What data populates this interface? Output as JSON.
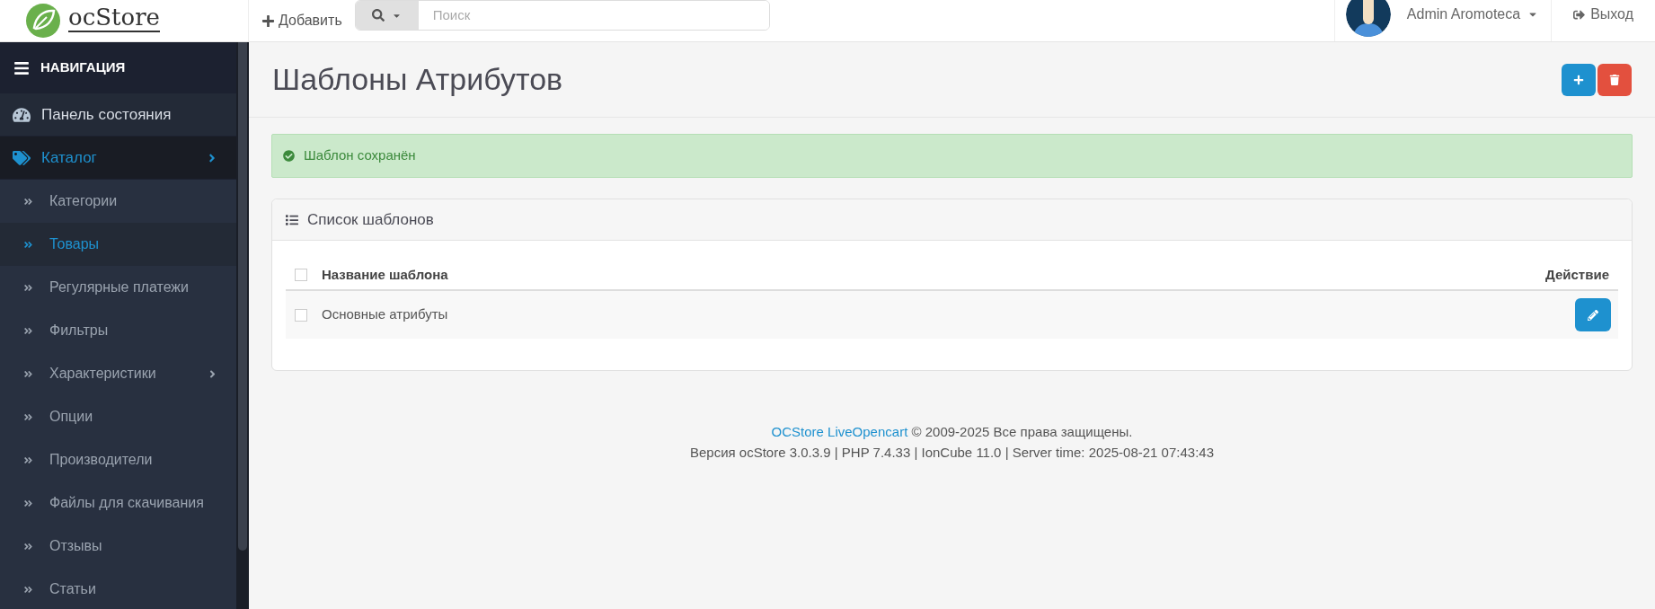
{
  "header": {
    "logo": "ocStore",
    "add_label": "Добавить",
    "search": {
      "placeholder": "Поиск"
    },
    "user": "Admin Aromoteca",
    "logout": "Выход"
  },
  "sidebar": {
    "title": "НАВИГАЦИЯ",
    "items": [
      {
        "label": "Панель состояния",
        "selected": false
      },
      {
        "label": "Каталог",
        "selected": true,
        "expanded": true,
        "children": [
          {
            "label": "Категории",
            "selected": false,
            "expandable": false
          },
          {
            "label": "Товары",
            "selected": true,
            "expandable": false
          },
          {
            "label": "Регулярные платежи",
            "selected": false,
            "expandable": false
          },
          {
            "label": "Фильтры",
            "selected": false,
            "expandable": false
          },
          {
            "label": "Характеристики",
            "selected": false,
            "expandable": true
          },
          {
            "label": "Опции",
            "selected": false,
            "expandable": false
          },
          {
            "label": "Производители",
            "selected": false,
            "expandable": false
          },
          {
            "label": "Файлы для скачивания",
            "selected": false,
            "expandable": false
          },
          {
            "label": "Отзывы",
            "selected": false,
            "expandable": false
          },
          {
            "label": "Статьи",
            "selected": false,
            "expandable": false
          }
        ]
      }
    ]
  },
  "page": {
    "title": "Шаблоны Атрибутов",
    "alert": "Шаблон сохранён",
    "panel": {
      "title": "Список шаблонов",
      "columns": [
        "Название шаблона",
        "Действие"
      ],
      "rows": [
        {
          "name": "Основные атрибуты",
          "checked": false
        }
      ],
      "select_all_checked": false
    }
  },
  "footer": {
    "link": "OCStore LiveOpencart",
    "copyright": "© 2009-2025 Все права защищены.",
    "version": "Версия ocStore 3.0.3.9 | PHP 7.4.33 | IonCube 11.0 | Server time: 2025-08-21 07:43:43"
  }
}
